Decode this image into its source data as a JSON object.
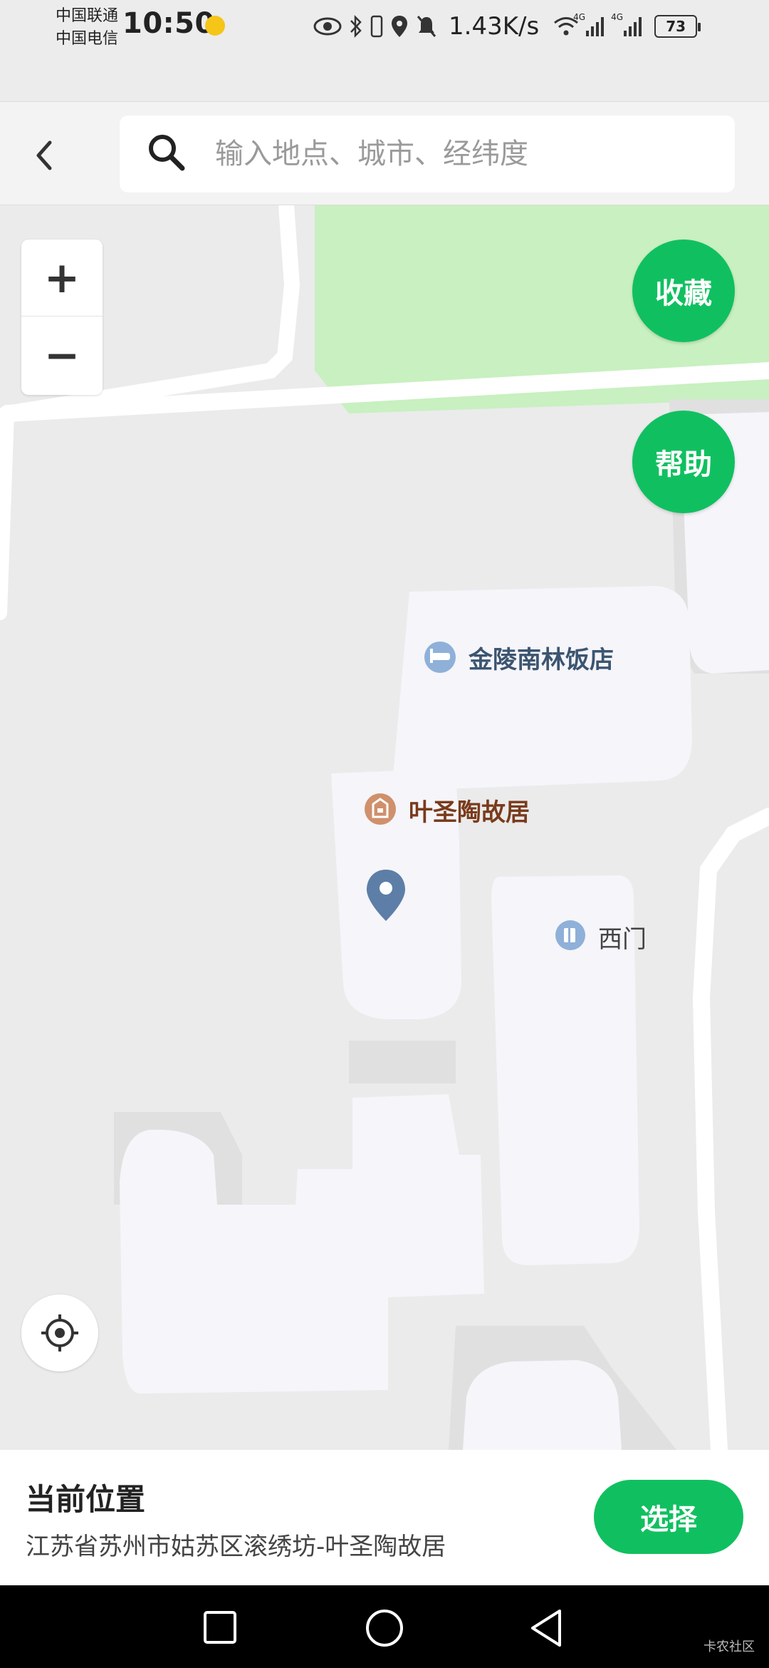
{
  "status_bar": {
    "carrier_1": "中国联通",
    "carrier_2": "中国电信",
    "time": "10:50",
    "network_speed": "1.43K/s",
    "battery": "73",
    "signal_1_type": "4G",
    "signal_2_type": "4G"
  },
  "search": {
    "placeholder": "输入地点、城市、经纬度"
  },
  "map": {
    "zoom_in": "+",
    "zoom_out": "−",
    "favorite_label": "收藏",
    "help_label": "帮助",
    "pois": {
      "hotel": "金陵南林饭店",
      "residence": "叶圣陶故居",
      "gate": "西门"
    }
  },
  "bottom": {
    "title": "当前位置",
    "address": "江苏省苏州市姑苏区滚绣坊-叶圣陶故居",
    "select_label": "选择"
  },
  "watermark": "卡农社区",
  "colors": {
    "accent": "#10c060",
    "park": "#c8f0c0",
    "building": "#f5f5fa"
  }
}
